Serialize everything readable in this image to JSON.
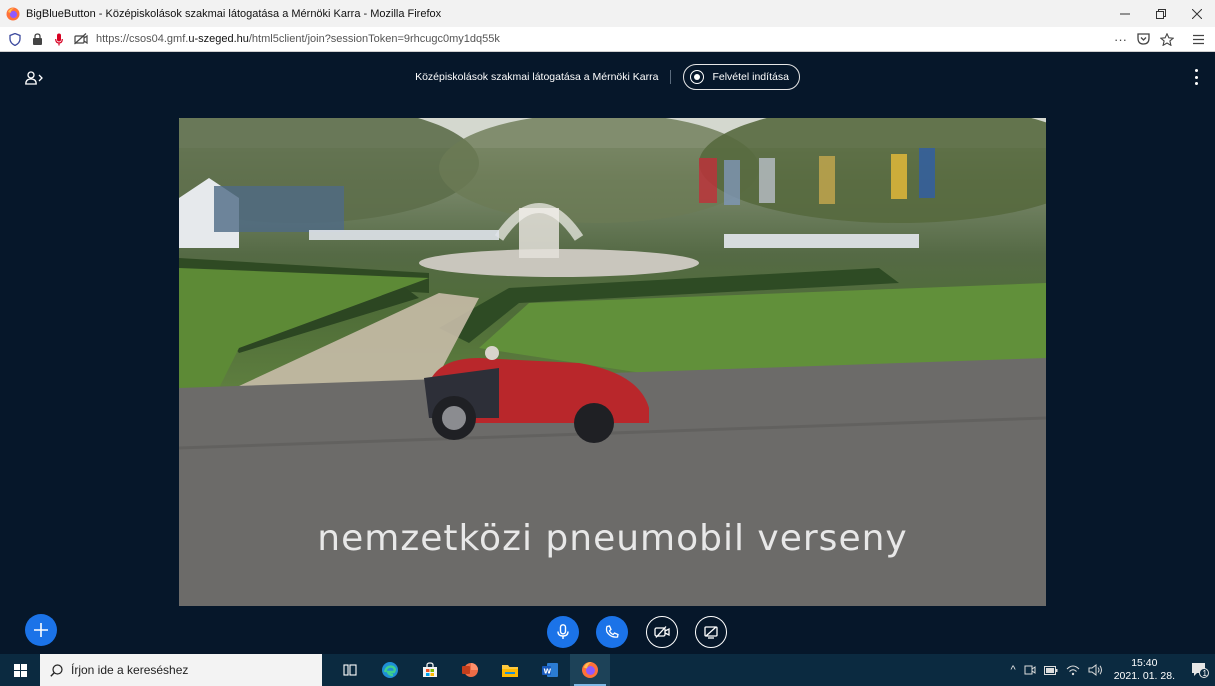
{
  "browser": {
    "window_title": "BigBlueButton - Középiskolások szakmai látogatása a Mérnöki Karra - Mozilla Firefox",
    "url_prefix": "https://csos04.gmf.",
    "url_host": "u-szeged.hu",
    "url_path": "/html5client/join?sessionToken=9rhcugc0my1dq55k"
  },
  "meeting": {
    "title": "Középiskolások szakmai látogatása a Mérnöki Karra",
    "record_label": "Felvétel indítása"
  },
  "video": {
    "caption": "nemzetközi pneumobil verseny"
  },
  "taskbar": {
    "search_placeholder": "Írjon ide a kereséshez",
    "time": "15:40",
    "date": "2021. 01. 28.",
    "notification_count": "1"
  },
  "colors": {
    "app_bg": "#06172a",
    "primary_blue": "#1b73e8",
    "taskbar_bg": "#0b2a40"
  }
}
